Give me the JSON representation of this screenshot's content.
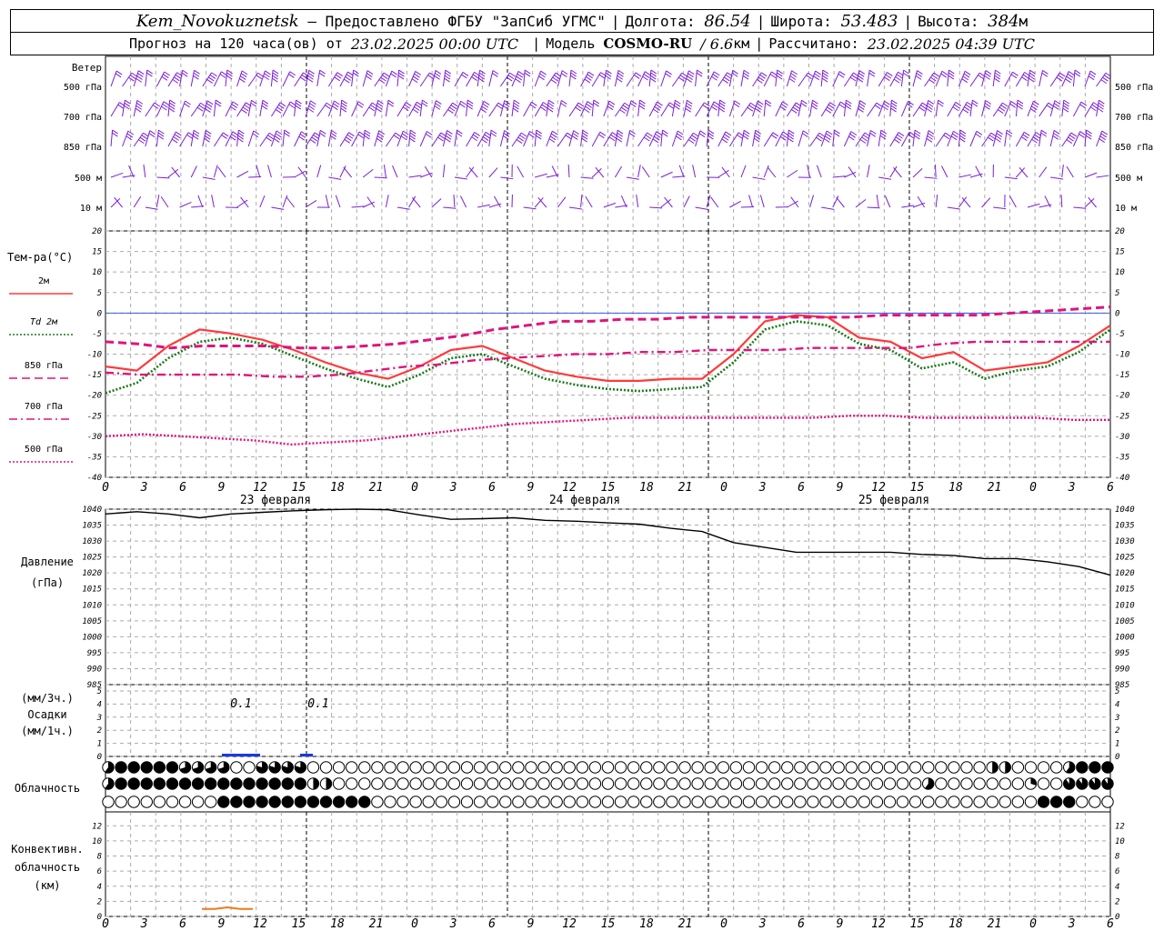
{
  "header": {
    "station": "Kem_Novokuznetsk",
    "provider": "— Предоставлено ФГБУ \"ЗапСиб УГМС\"",
    "lon_label": "Долгота:",
    "lon_value": "86.54",
    "lat_label": "Широта:",
    "lat_value": "53.483",
    "alt_label": "Высота:",
    "alt_value": "384",
    "alt_unit": "м",
    "forecast_prefix": "Прогноз на 120 часа(ов) от",
    "forecast_time": "23.02.2025 00:00 UTC",
    "model_label": "Модель",
    "model_name": "COSMO-RU",
    "model_res": "/ 6.6",
    "model_res_unit": "км",
    "calc_label": "Рассчитано:",
    "calc_time": "23.02.2025 04:39 UTC"
  },
  "wind_panel": {
    "title": "Ветер",
    "levels": [
      "500 гПа",
      "700 гПа",
      "850 гПа",
      "500 м",
      "10 м"
    ],
    "color": "#7a1fd6"
  },
  "temp_panel": {
    "title": "Тем-ра(°C)",
    "legend": [
      {
        "label": "2м",
        "color": "#ff3a3a",
        "style": "solid"
      },
      {
        "label": "Td 2м",
        "color": "#1a7a1a",
        "style": "dotted"
      },
      {
        "label": "850 гПа",
        "color": "#e0147a",
        "style": "dashed"
      },
      {
        "label": "700 гПа",
        "color": "#e0147a",
        "style": "dashdot"
      },
      {
        "label": "500 гПа",
        "color": "#e0147a",
        "style": "dotted"
      }
    ],
    "yticks": [
      "20",
      "15",
      "10",
      "5",
      "0",
      "-5",
      "-10",
      "-15",
      "-20",
      "-25",
      "-30",
      "-35",
      "-40"
    ]
  },
  "time_axis": {
    "hour_labels": [
      "0",
      "3",
      "6",
      "9",
      "12",
      "15",
      "18",
      "21",
      "0",
      "3",
      "6",
      "9",
      "12",
      "15",
      "18",
      "21",
      "0",
      "3",
      "6",
      "9",
      "12",
      "15",
      "18",
      "21",
      "0",
      "3",
      "6"
    ],
    "days": [
      "23 февраля",
      "24 февраля",
      "25 февраля"
    ]
  },
  "pressure_panel": {
    "title": "Давление",
    "unit": "(гПа)",
    "yticks": [
      "1040",
      "1035",
      "1030",
      "1025",
      "1020",
      "1015",
      "1010",
      "1005",
      "1000",
      "995",
      "990",
      "985"
    ]
  },
  "precip_panel": {
    "unit_top": "(мм/3ч.)",
    "title": "Осадки",
    "unit_bottom": "(мм/1ч.)",
    "yticks": [
      "5",
      "4",
      "3",
      "2",
      "1",
      "0"
    ],
    "annotations": [
      "0.1",
      "0.1"
    ]
  },
  "cloud_panel": {
    "title": "Облачность"
  },
  "conv_panel": {
    "title_line1": "Конвективн.",
    "title_line2": "облачность",
    "unit": "(км)",
    "yticks": [
      "12",
      "10",
      "8",
      "6",
      "4",
      "2",
      "0"
    ]
  },
  "chart_data": [
    {
      "type": "line",
      "name": "temperature",
      "x_hours": [
        0,
        3,
        6,
        9,
        12,
        15,
        18,
        21,
        24,
        27,
        30,
        33,
        36,
        39,
        42,
        45,
        48,
        51,
        54,
        57,
        60,
        63,
        66,
        69,
        72,
        75,
        78,
        81,
        84,
        87,
        90,
        93,
        96,
        99,
        102,
        105,
        108,
        111,
        114,
        117,
        120
      ],
      "ylim": [
        -40,
        20
      ],
      "series": [
        {
          "name": "2м",
          "values": [
            -13,
            -14,
            -8,
            -4,
            -5,
            -6.5,
            -9,
            -12,
            -14.5,
            -16,
            -13,
            -9,
            -8,
            -11,
            -14,
            -15.5,
            -16.5,
            -16.5,
            -16,
            -16,
            -10,
            -2,
            -0.5,
            -1,
            -6,
            -7,
            -11,
            -9.5,
            -14,
            -13,
            -12,
            -8,
            -3
          ]
        },
        {
          "name": "Td 2м",
          "values": [
            -19.5,
            -17,
            -11,
            -7,
            -6,
            -7.5,
            -10.5,
            -13.5,
            -16,
            -18,
            -15,
            -11,
            -10,
            -13,
            -16,
            -17.5,
            -18.5,
            -19,
            -18.5,
            -18,
            -12,
            -4,
            -2,
            -3,
            -7.5,
            -9,
            -13.5,
            -12,
            -16,
            -14,
            -13,
            -9.5,
            -4
          ]
        },
        {
          "name": "850 гПа",
          "values": [
            -7,
            -7.5,
            -8.5,
            -8,
            -8,
            -8,
            -8.5,
            -8.5,
            -8,
            -7.5,
            -6.5,
            -5.5,
            -4,
            -3,
            -2,
            -2,
            -1.5,
            -1.5,
            -1,
            -1,
            -1,
            -1,
            -1,
            -1,
            -0.5,
            -0.5,
            -0.5,
            -0.5,
            0,
            0.5,
            1,
            1.5
          ]
        },
        {
          "name": "700 гПа",
          "values": [
            -14.5,
            -15,
            -15,
            -15,
            -15,
            -15.5,
            -15.5,
            -15,
            -14,
            -13,
            -12.5,
            -11.5,
            -11,
            -10.5,
            -10,
            -10,
            -9.5,
            -9.5,
            -9,
            -9,
            -9,
            -8.5,
            -8.5,
            -8.5,
            -8.5,
            -7.5,
            -7,
            -7,
            -7,
            -7,
            -7
          ]
        },
        {
          "name": "500 гПа",
          "values": [
            -30,
            -29.5,
            -30,
            -30.5,
            -31,
            -32,
            -31.5,
            -31,
            -30,
            -29,
            -28,
            -27,
            -26.5,
            -26,
            -25.5,
            -25.5,
            -25.5,
            -25.5,
            -25.5,
            -25.5,
            -25,
            -25,
            -25.5,
            -25.5,
            -25.5,
            -25.5,
            -26,
            -26
          ]
        }
      ]
    },
    {
      "type": "line",
      "name": "pressure",
      "x_hours": [
        0,
        3,
        6,
        9,
        12,
        15,
        18,
        21,
        24,
        27,
        30,
        33,
        36,
        39,
        42,
        45,
        48,
        51,
        54,
        57,
        60,
        63,
        66,
        69,
        72,
        75,
        78,
        81,
        84,
        87,
        90,
        93,
        96,
        99,
        102,
        105,
        108,
        111,
        114,
        117,
        120
      ],
      "ylim": [
        985,
        1040
      ],
      "values": [
        1038.5,
        1039.2,
        1038.5,
        1037.3,
        1038.5,
        1039.0,
        1039.5,
        1039.8,
        1040.0,
        1039.8,
        1038.2,
        1036.8,
        1037.0,
        1037.3,
        1036.5,
        1036.2,
        1035.7,
        1035.3,
        1034.0,
        1033.0,
        1029.5,
        1028.0,
        1026.5,
        1026.5,
        1026.5,
        1026.5,
        1025.8,
        1025.5,
        1024.5,
        1024.5,
        1023.5,
        1022.0,
        1019.3
      ]
    },
    {
      "type": "bar",
      "name": "precipitation",
      "x_hours": [
        9,
        10,
        11,
        15
      ],
      "values": [
        0.1,
        0.1,
        0.1,
        0.1
      ],
      "ylim": [
        0,
        5
      ]
    },
    {
      "type": "line",
      "name": "convective clouds",
      "x_hours": [
        7.5,
        9,
        10,
        11,
        11.5
      ],
      "values": [
        1.0,
        1.0,
        1.2,
        1.0,
        1.0
      ],
      "ylim": [
        0,
        13
      ]
    }
  ]
}
